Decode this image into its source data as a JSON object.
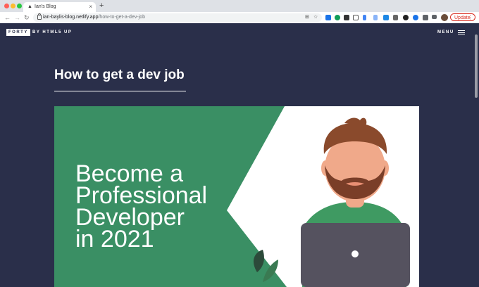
{
  "browser": {
    "tab_title": "Ian's Blog",
    "tab_icon": "▲",
    "close_glyph": "×",
    "new_tab_glyph": "+",
    "back_glyph": "←",
    "forward_glyph": "→",
    "reload_glyph": "↻",
    "url_host": "ian-baylis-blog.netlify.app",
    "url_path": "/how-to-get-a-dev-job",
    "update_label": "Update",
    "more_glyph": "⋮",
    "translate_glyph": "⊞",
    "star_glyph": "☆"
  },
  "site": {
    "logo": "FORTY",
    "byline": "BY HTML5 UP",
    "menu_label": "MENU"
  },
  "post": {
    "title": "How to get a dev job",
    "hero_lines": [
      "Become a",
      "Professional",
      "Developer",
      "in 2021"
    ]
  },
  "colors": {
    "page_bg": "#2a2f4a",
    "hero_green": "#3a8f64",
    "skin": "#f0a98a",
    "hair": "#8a4a2c",
    "beard": "#7a3e28",
    "shirt": "#3f9a62",
    "laptop": "#55525f"
  },
  "icons": {
    "back": "arrow-left-icon",
    "forward": "arrow-right-icon",
    "reload": "reload-icon",
    "lock": "lock-icon",
    "menu": "hamburger-icon"
  }
}
